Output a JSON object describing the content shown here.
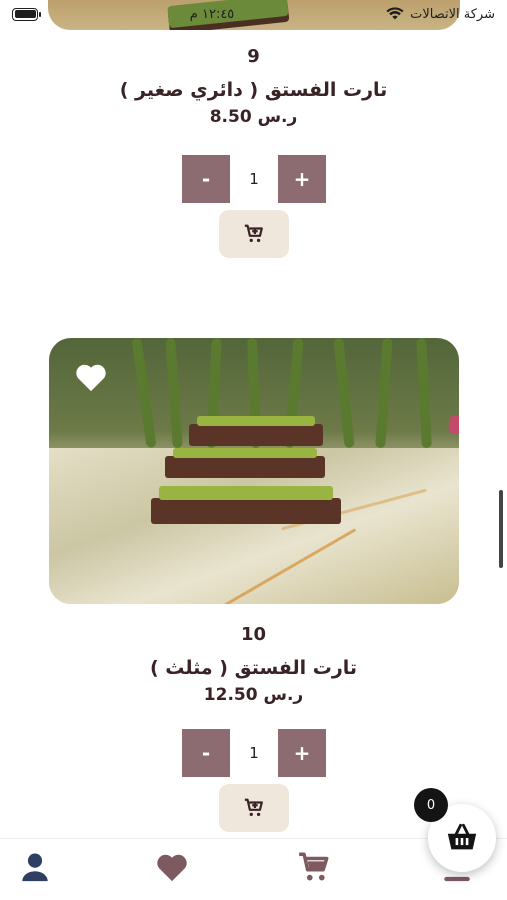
{
  "status_bar": {
    "carrier": "شركة الاتصالات",
    "time": "١٢:٤٥ م"
  },
  "products": [
    {
      "index": "9",
      "name": "تارت الفستق ( دائري صغير )",
      "price": "ر.س 8.50",
      "quantity": "1",
      "minus_label": "-",
      "plus_label": "+"
    },
    {
      "index": "10",
      "name": "تارت الفستق ( مثلث )",
      "price": "ر.س 12.50",
      "quantity": "1",
      "minus_label": "-",
      "plus_label": "+"
    }
  ],
  "cart_fab": {
    "count": "0",
    "icon": "basket-icon"
  },
  "bottom_nav": {
    "items": [
      {
        "icon": "user-icon"
      },
      {
        "icon": "heart-icon"
      },
      {
        "icon": "cart-icon"
      },
      {
        "icon": "menu-icon"
      }
    ]
  },
  "colors": {
    "accent": "#8c6b71",
    "text": "#3a2326",
    "nav_user": "#2f3f63",
    "nav_icon": "#7c5a60",
    "cart_btn_bg": "#efe6dc"
  }
}
